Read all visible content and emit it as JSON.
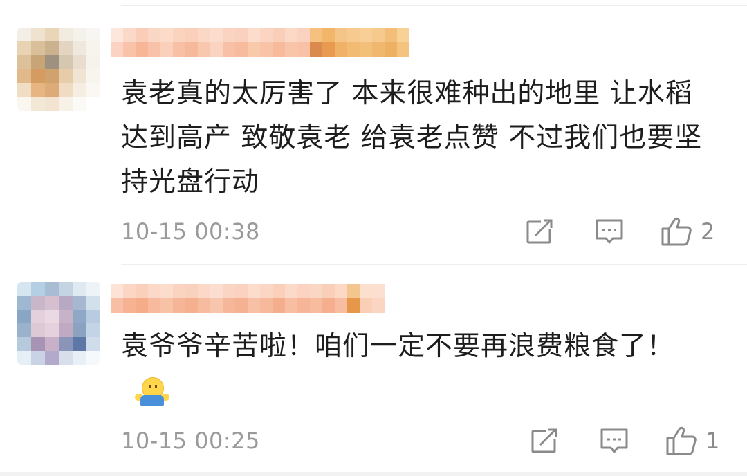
{
  "comments": [
    {
      "text": "袁老真的太厉害了 本来很难种出的地里 让水稻达到高产 致敬袁老 给袁老点赞 不过我们也要坚持光盘行动",
      "timestamp": "10-15 00:38",
      "like_count": "2",
      "has_emoji": false,
      "avatar_colors": [
        "#f4efe6",
        "#efe3cf",
        "#e9d6b9",
        "#f2ebe0",
        "#f5f2ec",
        "#f8f6f2",
        "#e8d3b2",
        "#d9c09a",
        "#c9b28d",
        "#e3d5c1",
        "#efe8de",
        "#f7f4ee",
        "#dcc19b",
        "#c8a577",
        "#9e917f",
        "#d6c7b1",
        "#e8ddcf",
        "#f6f2ec",
        "#e2b98a",
        "#d49c61",
        "#cfa26e",
        "#e6cca8",
        "#f0e4d3",
        "#f8f4ee",
        "#f1ddc3",
        "#e7b582",
        "#dcab77",
        "#efdcc3",
        "#f6eee3",
        "#fbf8f4",
        "#faf6f0",
        "#f3e7d6",
        "#f2e4d0",
        "#f8f1e7",
        "#fcfaf6",
        "#ffffff"
      ],
      "username_colors": [
        "#fde6dc",
        "#fbd9c9",
        "#f9cdb8",
        "#fad6c5",
        "#fcdcc9",
        "#fbd4c0",
        "#fad0bb",
        "#fbd7c5",
        "#fcdccc",
        "#fbd3c1",
        "#fad1be",
        "#fcdccd",
        "#fbd5c2",
        "#f9cfb9",
        "#fcd9c7",
        "#fbd2bf",
        "#f6c07e",
        "#f2b66a",
        "#f5c487",
        "#f7ca8f",
        "#f9cf98",
        "#f6c98c",
        "#f3bd7a",
        "#f8d197"
      ],
      "username_colors_b": [
        "#fcd3c2",
        "#f9c3aa",
        "#f7b695",
        "#f8c2a8",
        "#fad0ba",
        "#f8c0a4",
        "#f7b99b",
        "#f9c6ae",
        "#fbd3c1",
        "#f8c1a7",
        "#f7bc9e",
        "#f9caa9",
        "#f9c3a8",
        "#f7bb9c",
        "#f8c4aa",
        "#f9c2a7",
        "#d98a4c",
        "#e89a50",
        "#efb266",
        "#f1bb73",
        "#f3c07a",
        "#f0b86f",
        "#eeb063",
        "#f3c37f"
      ]
    },
    {
      "text": "袁爷爷辛苦啦！咱们一定不要再浪费粮食了！",
      "timestamp": "10-15 00:25",
      "like_count": "1",
      "has_emoji": true,
      "emoji_name": "shrug-emoji",
      "avatar_colors": [
        "#d6e6f1",
        "#b4cfe3",
        "#a8bcd4",
        "#c5d4e3",
        "#dfe9f2",
        "#eef3f8",
        "#9fb8d1",
        "#c9b7c9",
        "#d6c0cf",
        "#b7a9c3",
        "#a6b8d0",
        "#d2e0ec",
        "#8aa6c5",
        "#e3d0dc",
        "#ead8e2",
        "#c7b2c8",
        "#8fa8c6",
        "#b8cbe0",
        "#9bb2cd",
        "#ddc8d6",
        "#e5d1de",
        "#bfa9c3",
        "#8ba2c1",
        "#c3d4e6",
        "#b7c9dd",
        "#a794b5",
        "#c7b0c8",
        "#8b95ba",
        "#5d77a6",
        "#cfdceb",
        "#e6eef6",
        "#c9d3e5",
        "#b3aacb",
        "#d8dfeb",
        "#e9eff6",
        "#f6f9fc"
      ],
      "username_colors": [
        "#fde3d6",
        "#fbd6c4",
        "#fad0bb",
        "#fbd8c7",
        "#fcdccb",
        "#fbd4c1",
        "#fad1bd",
        "#fbd8c8",
        "#fcded0",
        "#fbd5c3",
        "#fad2bf",
        "#fcdccd",
        "#fbd6c4",
        "#fad0bb",
        "#fcdac9",
        "#fbd3c0",
        "#fad7c4",
        "#f9cfb9",
        "#fcd8c5",
        "#f3c58f",
        "#fbe0cd",
        "#fcdfd0"
      ],
      "username_colors_b": [
        "#f8bfa4",
        "#f6b393",
        "#f5ac89",
        "#f7ba9d",
        "#f8c2a7",
        "#f6b597",
        "#f5b090",
        "#f7bca0",
        "#f8c6ad",
        "#f6b699",
        "#f5b293",
        "#f8c0a5",
        "#f7b99b",
        "#f5ae8d",
        "#f8bea2",
        "#f6b597",
        "#f7bb9e",
        "#f5af8e",
        "#f8bda1",
        "#e7974a",
        "#f9d0b5",
        "#fad6c2"
      ]
    }
  ]
}
